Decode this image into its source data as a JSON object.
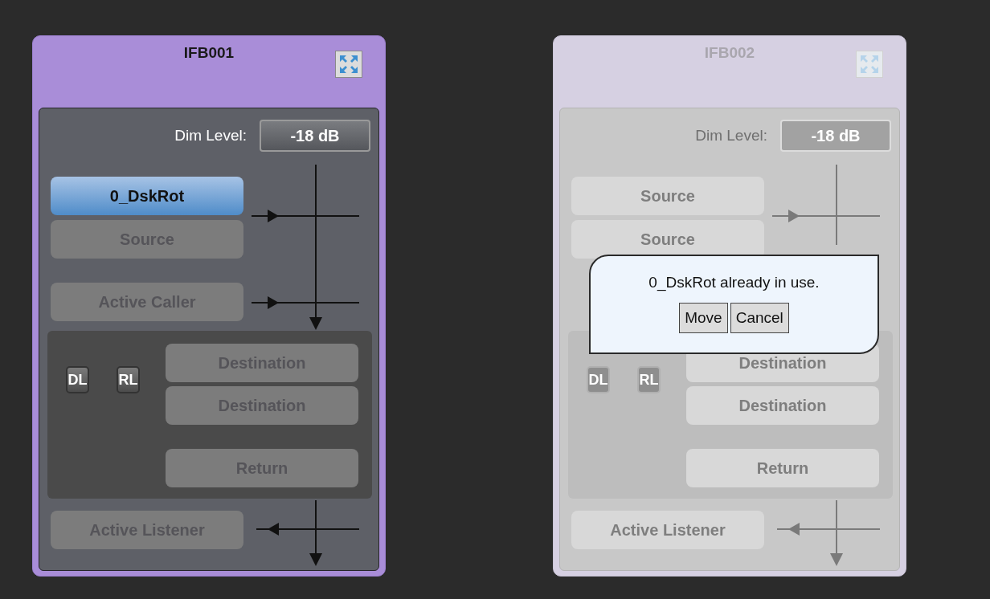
{
  "panels": [
    {
      "title": "IFB001",
      "disabled": false,
      "dim_label": "Dim Level:",
      "dim_value": "-18 dB",
      "sources": [
        {
          "label": "0_DskRot",
          "assigned": true
        },
        {
          "label": "Source",
          "assigned": false
        }
      ],
      "caller": "Active Caller",
      "badges": [
        "DL",
        "RL"
      ],
      "destinations": [
        "Destination",
        "Destination"
      ],
      "return": "Return",
      "listener": "Active Listener"
    },
    {
      "title": "IFB002",
      "disabled": true,
      "dim_label": "Dim Level:",
      "dim_value": "-18 dB",
      "sources": [
        {
          "label": "Source",
          "assigned": false
        },
        {
          "label": "Source",
          "assigned": false
        }
      ],
      "badges": [
        "DL",
        "RL"
      ],
      "destinations": [
        "Destination",
        "Destination"
      ],
      "return": "Return",
      "listener": "Active Listener",
      "popup": {
        "message": "0_DskRot already in use.",
        "buttons": [
          "Move",
          "Cancel"
        ]
      }
    }
  ]
}
